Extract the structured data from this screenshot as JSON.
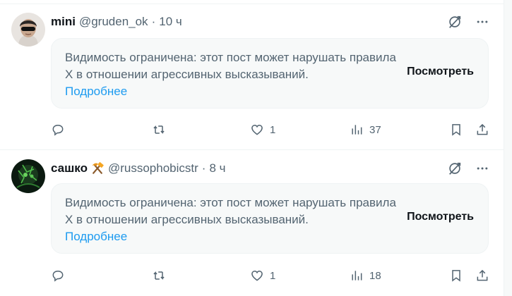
{
  "posts": [
    {
      "name": "mini",
      "handle": "@gruden_ok",
      "separator": "·",
      "time": "10 ч",
      "notice_text": "Видимость ограничена: этот пост может нарушать правила X в отношении агрессивных высказываний.",
      "learn_more": "Подробнее",
      "view_button": "Посмотреть",
      "likes": "1",
      "views": "37"
    },
    {
      "name": "сашко",
      "handle": "@russophobicstr",
      "separator": "·",
      "time": "8 ч",
      "notice_text": "Видимость ограничена: этот пост может нарушать правила X в отношении агрессивных высказываний.",
      "learn_more": "Подробнее",
      "view_button": "Посмотреть",
      "likes": "1",
      "views": "18"
    }
  ],
  "colors": {
    "text_primary": "#0f1419",
    "text_secondary": "#536471",
    "link": "#1d9bf0",
    "notice_bg": "#f7f9f9",
    "divider": "#eff3f4"
  },
  "icons": [
    "grok-icon",
    "more-icon",
    "reply-icon",
    "retweet-icon",
    "like-icon",
    "views-icon",
    "bookmark-icon",
    "share-icon",
    "hammer-pick-emoji"
  ]
}
